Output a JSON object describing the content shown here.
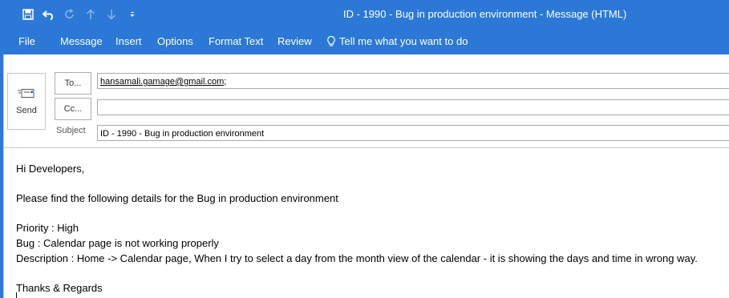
{
  "window": {
    "title": "ID - 1990 - Bug in production environment  -  Message (HTML)"
  },
  "quick_access": [
    {
      "name": "save-icon"
    },
    {
      "name": "undo-icon"
    },
    {
      "name": "redo-icon"
    },
    {
      "name": "up-arrow-icon"
    },
    {
      "name": "down-arrow-icon"
    },
    {
      "name": "customize-qat-icon"
    }
  ],
  "ribbon": {
    "tabs": [
      "File",
      "Message",
      "Insert",
      "Options",
      "Format Text",
      "Review"
    ],
    "tell_me": "Tell me what you want to do"
  },
  "compose": {
    "send_label": "Send",
    "to_label": "To...",
    "cc_label": "Cc...",
    "subject_label": "Subject",
    "to_value": "hansamali.gamage@gmail.com",
    "to_separator": ";",
    "cc_value": "",
    "subject_value": "ID - 1990 - Bug in production environment"
  },
  "message": {
    "greeting": "Hi Developers,",
    "intro": "Please find the following details for the Bug in production environment",
    "priority": "Priority : High",
    "bug": "Bug : Calendar page is not working properly",
    "description": "Description : Home -> Calendar page, When I try to select a day from the month view of the calendar - it is showing the days and time in wrong way.",
    "closing": "Thanks & Regards"
  },
  "colors": {
    "accent": "#2b78d6",
    "ribbon_text": "#ffffff"
  }
}
